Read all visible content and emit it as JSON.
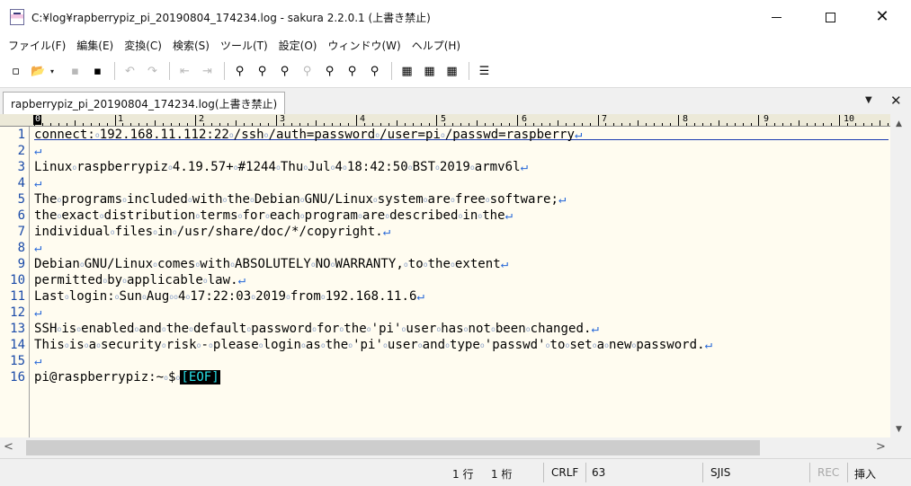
{
  "window": {
    "title": "C:¥log¥rapberrypiz_pi_20190804_174234.log - sakura 2.2.0.1 (上書き禁止)",
    "minimize_glyph": "",
    "maximize_glyph": "",
    "close_glyph": "✕"
  },
  "menu": {
    "items": [
      "ファイル(F)",
      "編集(E)",
      "変換(C)",
      "検索(S)",
      "ツール(T)",
      "設定(O)",
      "ウィンドウ(W)",
      "ヘルプ(H)"
    ]
  },
  "toolbar": {
    "icons": [
      "new-file-icon",
      "open-folder-icon",
      "save-icon",
      "save-all-icon",
      "undo-icon",
      "redo-icon",
      "move-back-icon",
      "move-forward-icon",
      "search-icon",
      "search-next-icon",
      "search-prev-icon",
      "replace-icon",
      "grep-icon",
      "bookmark-icon",
      "outline-icon",
      "compare-icon",
      "settings-icon",
      "font-icon",
      "window-list-icon"
    ],
    "glyphs": [
      "▫",
      "📂",
      "▾",
      "▪",
      "▪",
      "↶",
      "↷",
      "⇤",
      "⇥",
      "⚲",
      "⚲",
      "⚲",
      "⚲",
      "⚲",
      "⚲",
      "⚲",
      "▦",
      "▦",
      "▦",
      "☰"
    ]
  },
  "tab": {
    "label": "rapberrypiz_pi_20190804_174234.log(上書き禁止)",
    "menu_glyph": "▼",
    "close_glyph": "✕"
  },
  "ruler": {
    "cursor_label": "0",
    "labels": [
      "1",
      "2",
      "3",
      "4",
      "5",
      "6",
      "7",
      "8",
      "9",
      "10"
    ]
  },
  "editor": {
    "line_numbers": [
      "1",
      "2",
      "3",
      "4",
      "5",
      "6",
      "7",
      "8",
      "9",
      "10",
      "11",
      "12",
      "13",
      "14",
      "15",
      "16"
    ],
    "lines": [
      "connect:·192.168.11.112:22·/ssh·/auth=password·/user=pi·/passwd=raspberry",
      "",
      "Linux·raspberrypiz·4.19.57+·#1244·Thu·Jul·4·18:42:50·BST·2019·armv6l",
      "",
      "The·programs·included·with·the·Debian·GNU/Linux·system·are·free·software;",
      "the·exact·distribution·terms·for·each·program·are·described·in·the",
      "individual·files·in·/usr/share/doc/*/copyright.",
      "",
      "Debian·GNU/Linux·comes·with·ABSOLUTELY·NO·WARRANTY,·to·the·extent",
      "permitted·by·applicable·law.",
      "Last·login:·Sun·Aug··4·17:22:03·2019·from·192.168.11.6",
      "",
      "SSH·is·enabled·and·the·default·password·for·the·'pi'·user·has·not·been·changed.",
      "This·is·a·security·risk·-·please·login·as·the·'pi'·user·and·type·'passwd'·to·set·a·new·password.",
      "",
      "pi@raspberrypiz:~·$·"
    ],
    "newline_glyph": "↵",
    "eof_marker": "[EOF]"
  },
  "scrollbars": {
    "up_glyph": "▲",
    "down_glyph": "▼",
    "left_glyph": "<",
    "right_glyph": ">"
  },
  "status": {
    "line": "1 行",
    "column": "1 桁",
    "newline": "CRLF",
    "char_code": "63",
    "encoding": "SJIS",
    "rec": "REC",
    "insert": "挿入"
  }
}
